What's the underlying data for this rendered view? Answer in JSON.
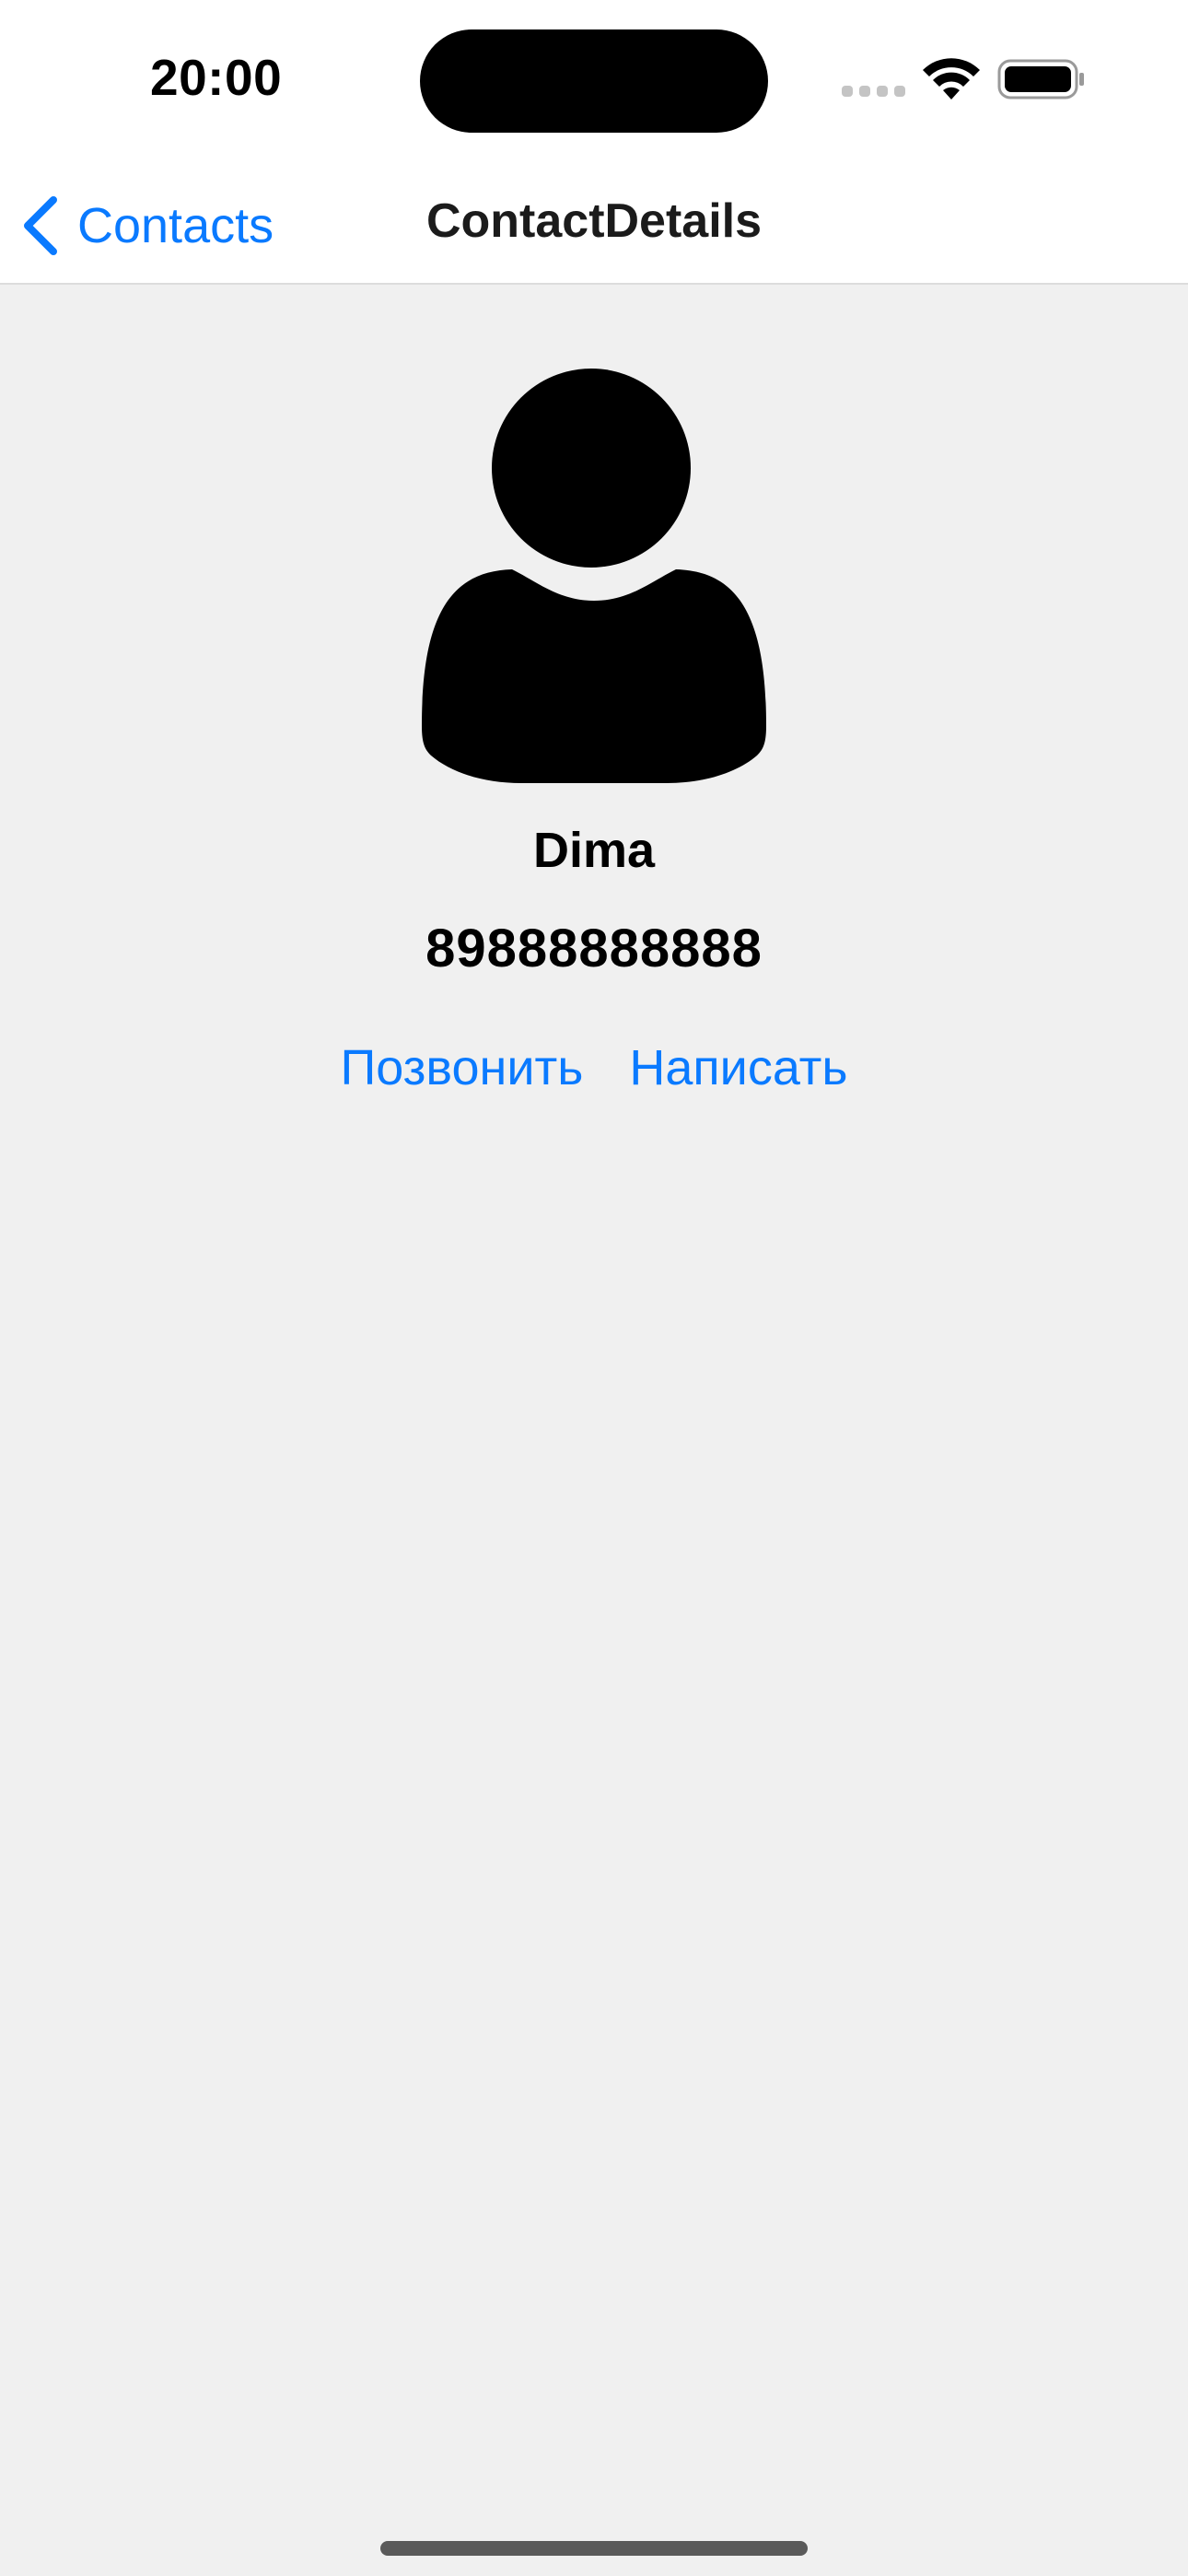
{
  "status_bar": {
    "time": "20:00",
    "signal_icon": "signal-icon",
    "wifi_icon": "wifi-icon",
    "battery_icon": "battery-icon"
  },
  "nav_bar": {
    "back_label": "Contacts",
    "back_icon": "chevron-left-icon",
    "title": "ContactDetails"
  },
  "contact": {
    "avatar_icon": "person-icon",
    "name": "Dima",
    "phone": "89888888888"
  },
  "actions": {
    "call_label": "Позвонить",
    "message_label": "Написать"
  },
  "colors": {
    "accent": "#0a7aff",
    "background": "#f0f0f0",
    "nav_background": "#ffffff"
  }
}
